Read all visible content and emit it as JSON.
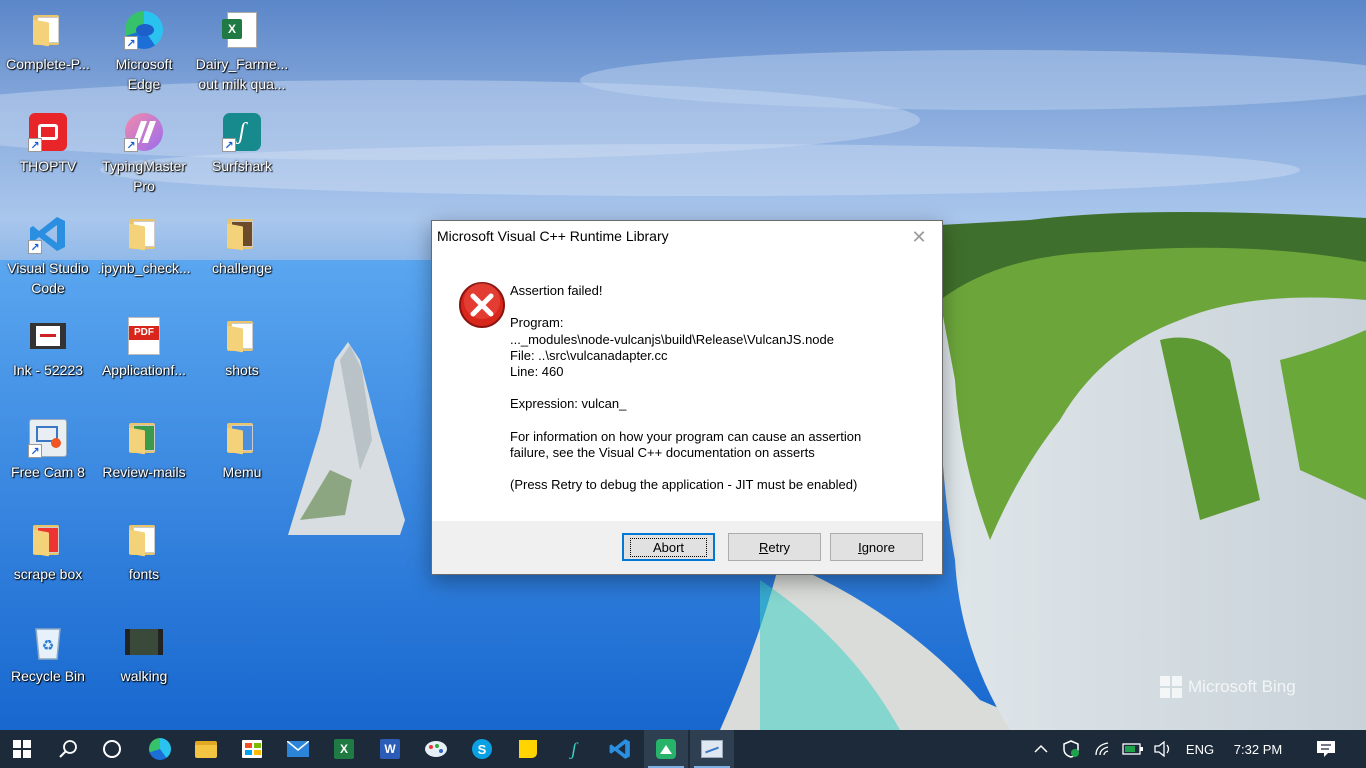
{
  "desktop": {
    "icons": [
      {
        "label": "Complete-P..."
      },
      {
        "label": "Microsoft\nEdge"
      },
      {
        "label": "Dairy_Farme...\nout milk qua..."
      },
      {
        "label": "THOPTV"
      },
      {
        "label": "TypingMaster\nPro"
      },
      {
        "label": "Surfshark"
      },
      {
        "label": "Visual Studio\nCode"
      },
      {
        "label": ".ipynb_check..."
      },
      {
        "label": "challenge"
      },
      {
        "label": "Ink - 52223"
      },
      {
        "label": "Applicationf..."
      },
      {
        "label": "shots"
      },
      {
        "label": "Free Cam 8"
      },
      {
        "label": "Review-mails"
      },
      {
        "label": "Memu"
      },
      {
        "label": "scrape box"
      },
      {
        "label": "fonts"
      },
      {
        "label": "Recycle Bin"
      },
      {
        "label": "walking"
      }
    ],
    "watermark": "Microsoft Bing"
  },
  "dialog": {
    "title": "Microsoft Visual C++ Runtime Library",
    "close_glyph": "✕",
    "heading": "Assertion failed!",
    "program_label": "Program:",
    "program_path": "..._modules\\node-vulcanjs\\build\\Release\\VulcanJS.node",
    "file_line": "File: ..\\src\\vulcanadapter.cc",
    "line_line": "Line: 460",
    "expression_line": "Expression: vulcan_",
    "info_line1": "For information on how your program can cause an assertion",
    "info_line2": "failure, see the Visual C++ documentation on asserts",
    "press_retry": "(Press Retry to debug the application - JIT must be enabled)",
    "buttons": {
      "abort": "Abort",
      "retry": "Retry",
      "ignore": "Ignore"
    }
  },
  "taskbar": {
    "pinned": [
      "start-icon",
      "search-icon",
      "task-view-icon",
      "edge-icon",
      "file-explorer-icon",
      "store-icon",
      "mail-icon",
      "excel-icon",
      "word-icon",
      "paint-icon",
      "skype-icon",
      "sticky-notes-icon",
      "surfshark-icon",
      "vscode-icon",
      "memu-icon",
      "freecam-icon"
    ],
    "excel_letter": "X",
    "word_letter": "W",
    "skype_letter": "S",
    "pdf_text": "PDF",
    "language": "ENG",
    "time": "7:32 PM"
  },
  "colors": {
    "taskbar": "#1c2a3a",
    "accent": "#0078d7",
    "error_red": "#d9261c"
  }
}
